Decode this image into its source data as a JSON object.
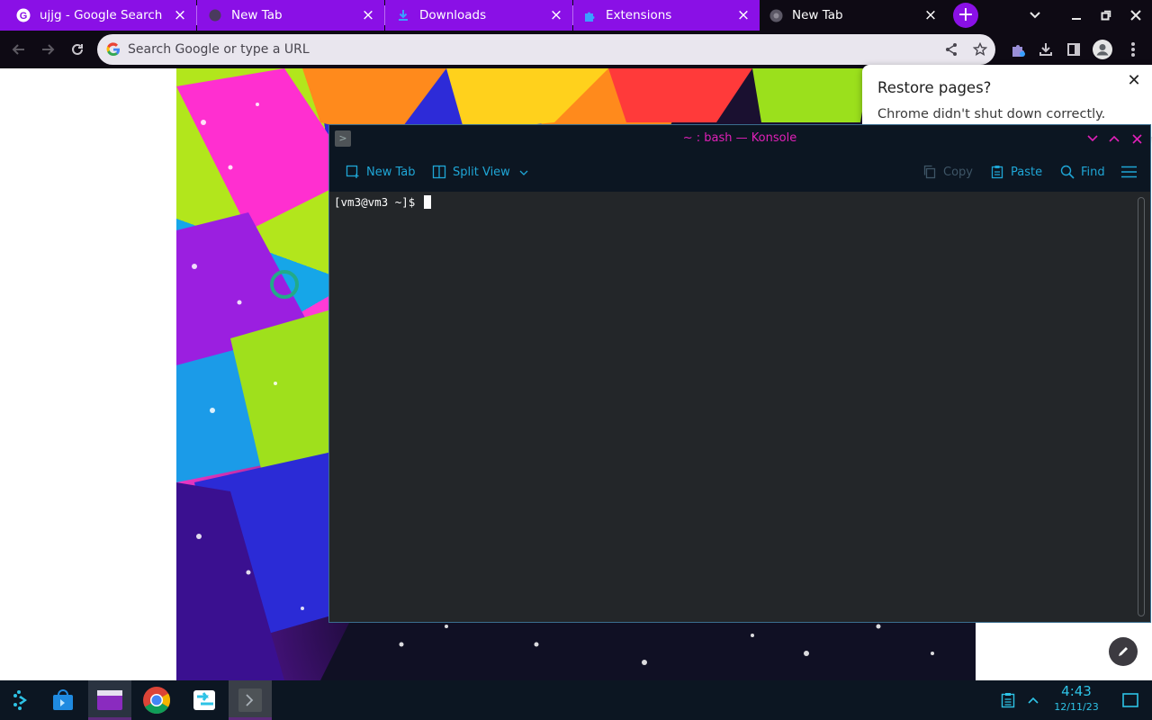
{
  "browser": {
    "tabs": [
      {
        "title": "ujjg - Google Search",
        "icon": "google-g-icon",
        "active": false
      },
      {
        "title": "New Tab",
        "icon": "newtab-icon",
        "active": false
      },
      {
        "title": "Downloads",
        "icon": "download-icon",
        "active": false
      },
      {
        "title": "Extensions",
        "icon": "puzzle-icon",
        "active": false
      },
      {
        "title": "New Tab",
        "icon": "chrome-icon",
        "active": true
      }
    ],
    "new_tab_symbol": "+",
    "close_symbol": "×",
    "omnibox_placeholder": "Search Google or type a URL",
    "accent_color": "#8a10e6"
  },
  "restore_bubble": {
    "title": "Restore pages?",
    "message": "Chrome didn't shut down correctly.",
    "close_symbol": "✕"
  },
  "konsole": {
    "window_title": "~ : bash — Konsole",
    "toolbar": {
      "new_tab": "New Tab",
      "split_view": "Split View",
      "copy": "Copy",
      "paste": "Paste",
      "find": "Find"
    },
    "prompt": "[vm3@vm3 ~]$ ",
    "title_color": "#e020b8",
    "accent_color": "#1fa6d6"
  },
  "taskbar": {
    "apps": [
      "launcher-icon",
      "app-store-icon",
      "file-manager-icon",
      "chrome-icon",
      "remote-desktop-icon",
      "konsole-icon"
    ],
    "clock_time": "4:43",
    "clock_date": "12/11/23",
    "accent_color": "#2ec3e6"
  }
}
